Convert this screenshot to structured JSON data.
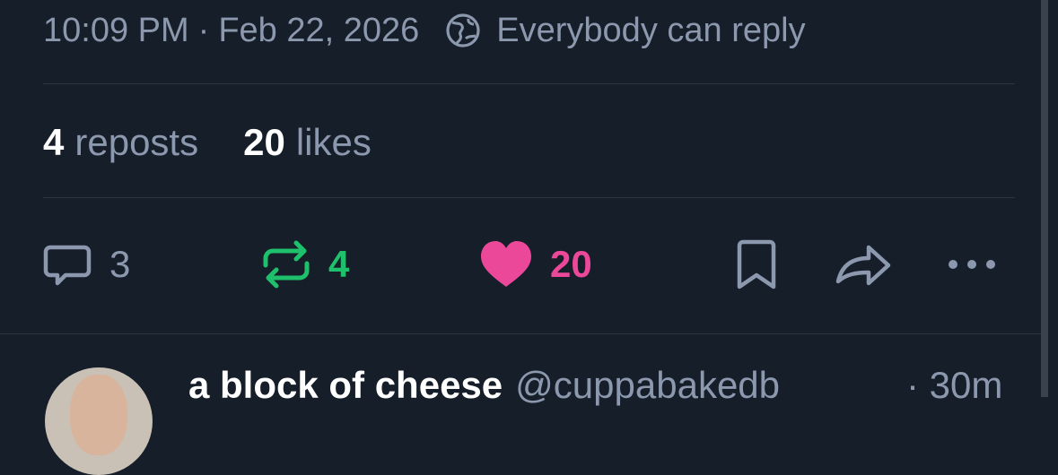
{
  "post_meta": {
    "time": "10:09 PM",
    "separator": "·",
    "date": "Feb 22, 2026",
    "reply_setting": "Everybody can reply",
    "reply_icon": "globe-icon"
  },
  "engagement": {
    "reposts_count": "4",
    "reposts_label": "reposts",
    "likes_count": "20",
    "likes_label": "likes"
  },
  "actions": {
    "reply": {
      "icon": "reply-icon",
      "count": "3"
    },
    "repost": {
      "icon": "repost-icon",
      "count": "4",
      "color": "#1ec06b"
    },
    "like": {
      "icon": "heart-icon",
      "count": "20",
      "color": "#ec4899"
    },
    "bookmark": {
      "icon": "bookmark-icon"
    },
    "share": {
      "icon": "share-icon"
    },
    "more": {
      "icon": "more-icon"
    }
  },
  "next_post": {
    "author_name": "a block of cheese",
    "author_handle": "@cuppabakedb",
    "timestamp": "· 30m"
  },
  "colors": {
    "background": "#161e2a",
    "muted_text": "#8b98ae",
    "divider": "#2b3545"
  }
}
